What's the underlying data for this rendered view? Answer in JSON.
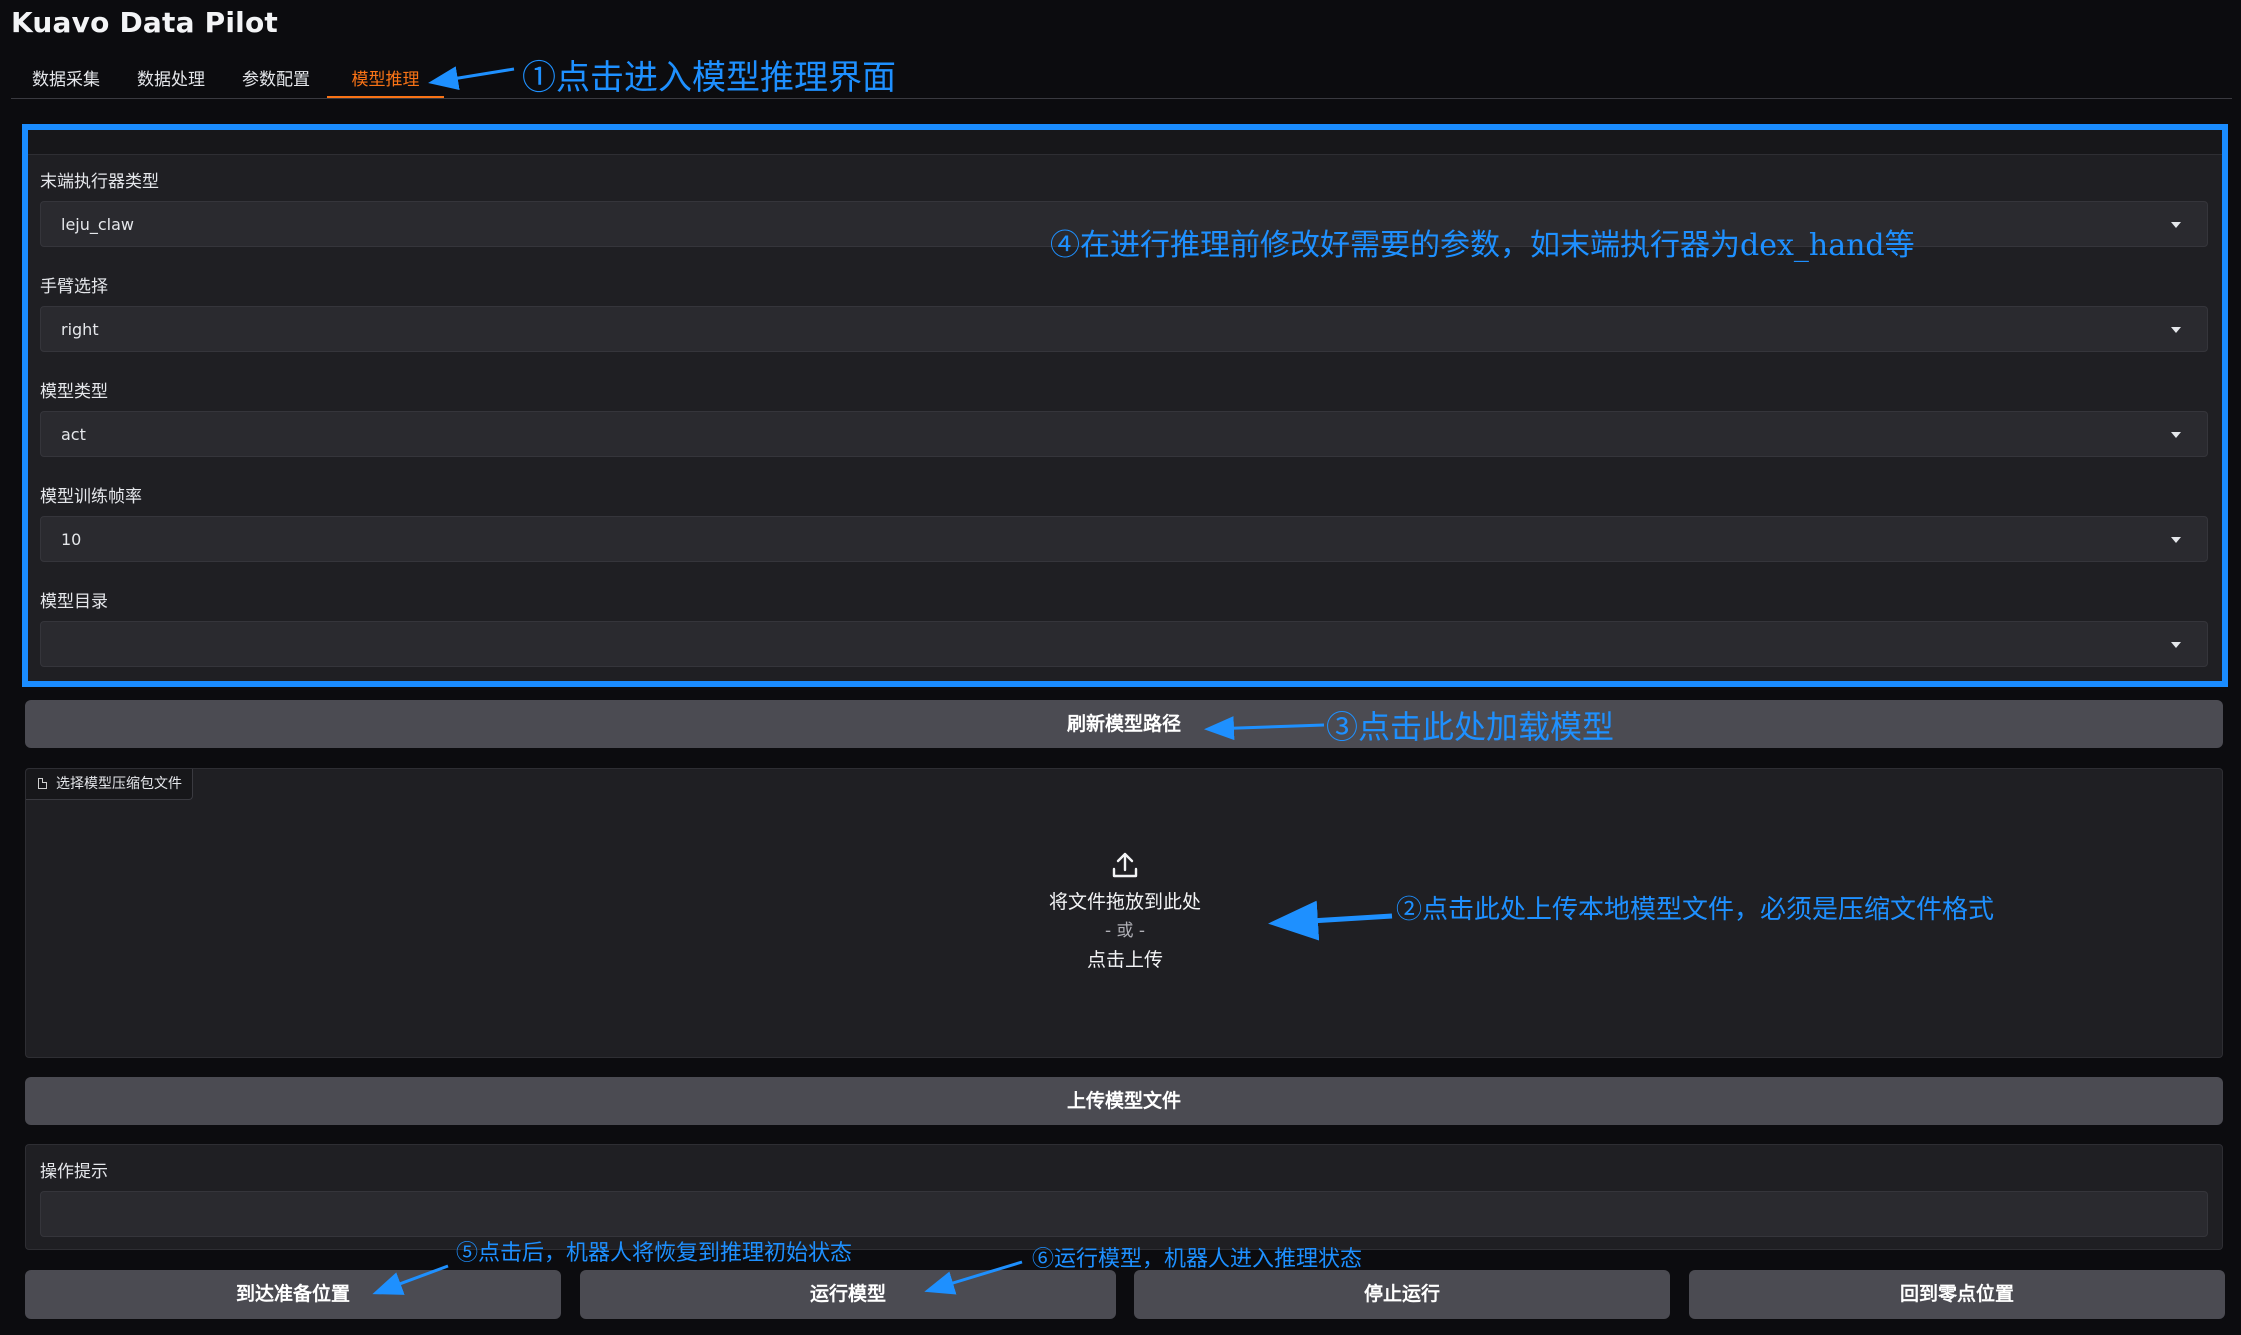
{
  "app": {
    "title": "Kuavo Data Pilot"
  },
  "tabs": [
    {
      "label": "数据采集",
      "active": false
    },
    {
      "label": "数据处理",
      "active": false
    },
    {
      "label": "参数配置",
      "active": false
    },
    {
      "label": "模型推理",
      "active": true
    }
  ],
  "params": {
    "end_effector": {
      "label": "末端执行器类型",
      "value": "leju_claw"
    },
    "arm": {
      "label": "手臂选择",
      "value": "right"
    },
    "model_type": {
      "label": "模型类型",
      "value": "act"
    },
    "train_fps": {
      "label": "模型训练帧率",
      "value": "10"
    },
    "model_dir": {
      "label": "模型目录",
      "value": ""
    }
  },
  "refresh_button": "刷新模型路径",
  "upload": {
    "label": "选择模型压缩包文件",
    "drop_text": "将文件拖放到此处",
    "or_text": "- 或 -",
    "click_text": "点击上传"
  },
  "upload_button": "上传模型文件",
  "hint": {
    "label": "操作提示",
    "value": ""
  },
  "actions": {
    "ready": "到达准备位置",
    "run": "运行模型",
    "stop": "停止运行",
    "zero": "回到零点位置"
  },
  "annotations": {
    "a1": "①点击进入模型推理界面",
    "a2": "②点击此处上传本地模型文件，必须是压缩文件格式",
    "a3": "③点击此处加载模型",
    "a4": "④在进行推理前修改好需要的参数，如末端执行器为dex_hand等",
    "a5": "⑤点击后，机器人将恢复到推理初始状态",
    "a6": "⑥运行模型，机器人进入推理状态"
  },
  "colors": {
    "accent": "#f97316",
    "annotation": "#1e90ff",
    "button": "#4b4b52",
    "background": "#0c0c0f"
  },
  "icons": [
    "upload-icon",
    "file-icon",
    "chevron-down-icon"
  ]
}
